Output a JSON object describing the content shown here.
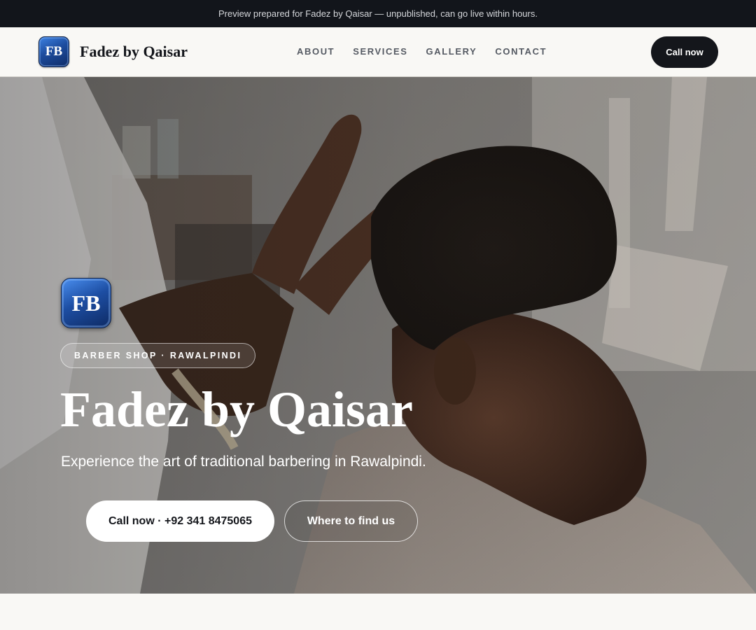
{
  "topbar": {
    "text": "Preview prepared for Fadez by Qaisar — unpublished, can go live within hours."
  },
  "nav": {
    "logo_text": "FB",
    "brand": "Fadez by Qaisar",
    "links": [
      "ABOUT",
      "SERVICES",
      "GALLERY",
      "CONTACT"
    ],
    "call_label": "Call now"
  },
  "hero": {
    "logo_text": "FB",
    "badge": "BARBER SHOP · RAWALPINDI",
    "title": "Fadez by Qaisar",
    "subtitle": "Experience the art of traditional barbering in Rawalpindi.",
    "primary_cta": "Call now · +92 341 8475065",
    "secondary_cta": "Where to find us"
  },
  "colors": {
    "topbar_bg": "#12151b",
    "nav_bg": "#f9f8f5",
    "accent_dark": "#14161b",
    "logo_blue": "#1d4c9e"
  },
  "icons": {
    "hero_image": "barber-cutting-hair-photo"
  }
}
